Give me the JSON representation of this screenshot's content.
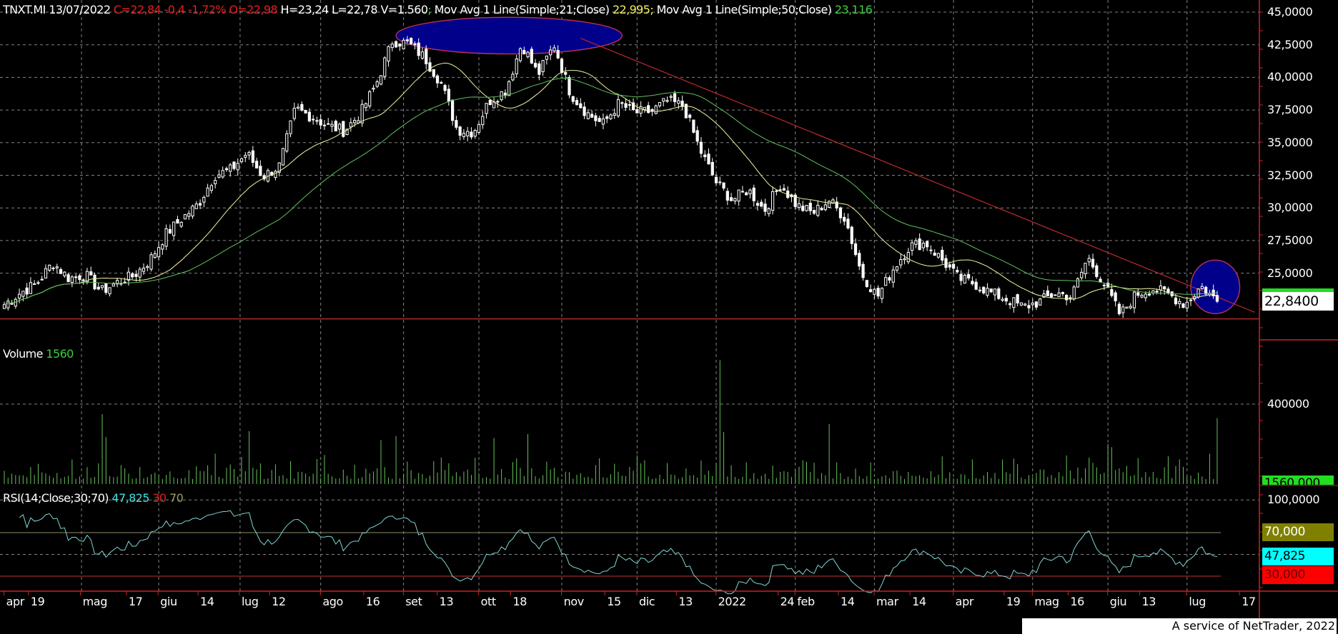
{
  "header": {
    "symbol_date": "TNXT.MI 13/07/2022",
    "close_change": "C=22,84 -0,4 -1,72% O=22,98",
    "hlv": "H=23,24 L=22,78 V=1.560",
    "sep": ";",
    "ma21_label": "Mov Avg 1 Line(Simple;21;Close)",
    "ma21_value": "22,995",
    "ma50_label": "Mov Avg 1 Line(Simple;50;Close)",
    "ma50_value": "23,116"
  },
  "volume_panel": {
    "label": "Volume",
    "value": "1560",
    "box": "1560,000"
  },
  "rsi_panel": {
    "label": "RSI(14;Close;30;70)",
    "value": "47,825",
    "low": "30",
    "high": "70",
    "box_high": "70,000",
    "box_value": "47,825",
    "box_low": "30,000"
  },
  "last_price_box": "22,8400",
  "footer": "A service of NetTrader, 2022",
  "colors": {
    "candle": "#ffffff",
    "ma21": "#f4f4a0",
    "ma50": "#5fc05f",
    "volume": "#66c25a",
    "rsi": "#7fd6d6",
    "trend": "#b02828",
    "annotation_fill": "#00008b",
    "annotation_edge": "#b0305a"
  },
  "chart_data": {
    "type": "candlestick",
    "symbol": "TNXT.MI",
    "days": 323,
    "weekly_closes": [
      22.6,
      23.5,
      24.2,
      25.8,
      24.6,
      24.9,
      23.6,
      24.3,
      24.8,
      26.0,
      28.0,
      29.2,
      30.3,
      32.5,
      32.9,
      34.2,
      32.4,
      33.2,
      37.6,
      37.0,
      36.3,
      35.9,
      37.2,
      39.5,
      42.8,
      42.6,
      41.5,
      39.6,
      36.0,
      35.8,
      38.2,
      39.0,
      42.6,
      40.2,
      42.5,
      38.8,
      37.3,
      36.4,
      38.0,
      37.3,
      37.4,
      38.2,
      37.8,
      34.5,
      32.0,
      30.6,
      31.4,
      29.8,
      31.8,
      30.2,
      29.6,
      30.6,
      29.2,
      25.0,
      23.2,
      25.4,
      27.1,
      27.3,
      26.0,
      24.6,
      24.2,
      23.5,
      23.0,
      22.4,
      22.8,
      23.5,
      23.2,
      26.2,
      24.2,
      21.8,
      23.4,
      23.8,
      23.4,
      22.6,
      24.0,
      22.84
    ],
    "price_axis": {
      "ticks": [
        "45,0000",
        "42,5000",
        "40,0000",
        "37,5000",
        "35,0000",
        "32,5000",
        "30,0000",
        "27,5000",
        "25,0000"
      ],
      "tick_values": [
        45,
        42.5,
        40,
        37.5,
        35,
        32.5,
        30,
        27.5,
        25
      ],
      "range": [
        22.0,
        45.0
      ]
    },
    "volume_axis": {
      "ticks": [
        "400000"
      ],
      "tick_values": [
        400000
      ]
    },
    "volume_spikes": [
      [
        26,
        350000
      ],
      [
        27,
        235000
      ],
      [
        65,
        265000
      ],
      [
        100,
        220000
      ],
      [
        104,
        240000
      ],
      [
        130,
        230000
      ],
      [
        139,
        250000
      ],
      [
        190,
        620000
      ],
      [
        191,
        260000
      ],
      [
        219,
        300000
      ],
      [
        293,
        200000
      ],
      [
        294,
        185000
      ],
      [
        322,
        330000
      ]
    ],
    "rsi_axis": {
      "ticks": [
        "100,0000"
      ],
      "tick_values": [
        100
      ],
      "levels": [
        30,
        70
      ]
    },
    "support_level": 21.5,
    "trendline": [
      {
        "day": 153,
        "price": 43.0
      },
      {
        "day": 332,
        "price": 22.0
      }
    ],
    "annotations": [
      {
        "shape": "ellipse",
        "day_from": 104,
        "day_to": 164,
        "price_from": 41.8,
        "price_to": 44.6
      },
      {
        "shape": "ellipse",
        "day_from": 315,
        "day_to": 328,
        "price_from": 21.9,
        "price_to": 26.0
      }
    ],
    "x_labels": [
      {
        "t": "apr",
        "d": 0.5
      },
      {
        "t": "19",
        "d": 7
      },
      {
        "t": "mag",
        "d": 20.8
      },
      {
        "t": "17",
        "d": 33
      },
      {
        "t": "giu",
        "d": 41.4
      },
      {
        "t": "14",
        "d": 52
      },
      {
        "t": "lug",
        "d": 63
      },
      {
        "t": "12",
        "d": 71
      },
      {
        "t": "ago",
        "d": 84.5
      },
      {
        "t": "16",
        "d": 96
      },
      {
        "t": "set",
        "d": 106.5
      },
      {
        "t": "13",
        "d": 115.5
      },
      {
        "t": "ott",
        "d": 126.5
      },
      {
        "t": "18",
        "d": 135
      },
      {
        "t": "nov",
        "d": 148.5
      },
      {
        "t": "15",
        "d": 160
      },
      {
        "t": "dic",
        "d": 168.5
      },
      {
        "t": "13",
        "d": 179
      },
      {
        "t": "2022",
        "d": 189.5
      },
      {
        "t": "24",
        "d": 206
      },
      {
        "t": "feb",
        "d": 210.5
      },
      {
        "t": "14",
        "d": 222
      },
      {
        "t": "mar",
        "d": 231.5
      },
      {
        "t": "14",
        "d": 241
      },
      {
        "t": "apr",
        "d": 252.5
      },
      {
        "t": "19",
        "d": 266
      },
      {
        "t": "mag",
        "d": 273.5
      },
      {
        "t": "16",
        "d": 283
      },
      {
        "t": "giu",
        "d": 293.5
      },
      {
        "t": "13",
        "d": 302
      },
      {
        "t": "lug",
        "d": 314.5
      },
      {
        "t": "17",
        "d": 328.5
      }
    ],
    "month_grid_days": [
      20.5,
      41,
      62.6,
      84,
      106,
      126,
      148,
      168,
      189,
      210,
      231,
      252,
      273,
      293,
      314
    ]
  }
}
